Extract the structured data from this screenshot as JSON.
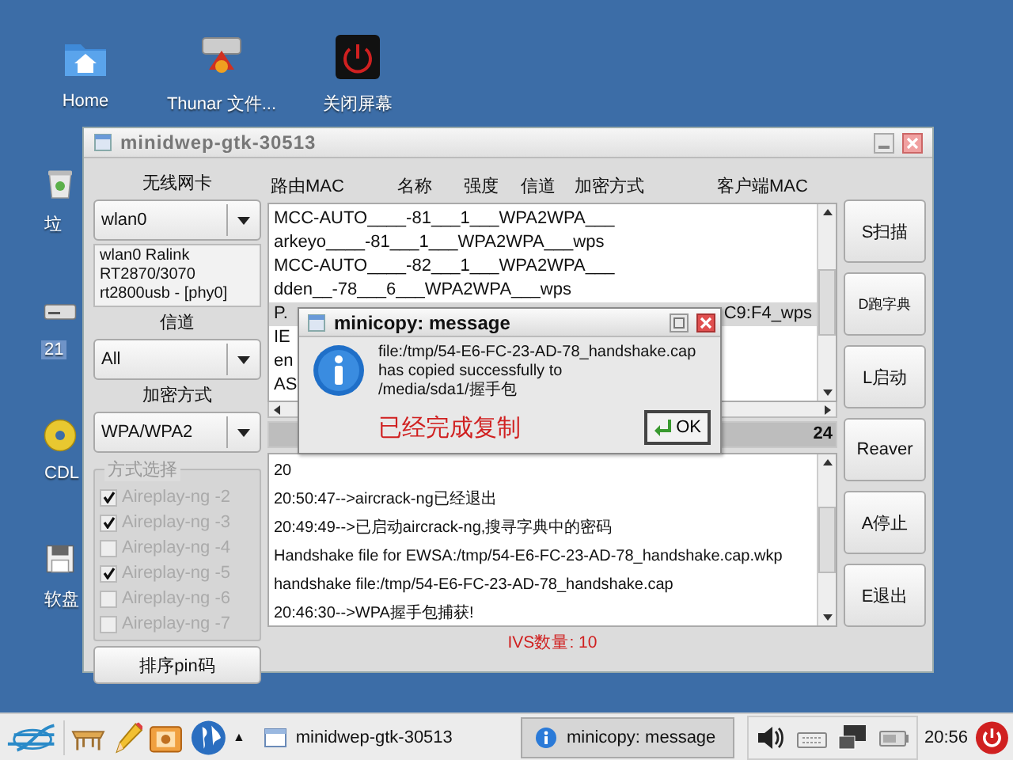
{
  "desktop": {
    "top_icons": [
      {
        "kind": "home",
        "label": "Home",
        "selected": false
      },
      {
        "kind": "cabinet",
        "label": "Thunar 文件...",
        "selected": false
      },
      {
        "kind": "power",
        "label": "关闭屏幕",
        "selected": false
      }
    ],
    "left_icons": [
      {
        "kind": "trash",
        "label": "垃",
        "selected": false
      },
      {
        "kind": "drive",
        "label": "21",
        "selected": true
      },
      {
        "kind": "disc",
        "label": "CDL",
        "selected": false
      },
      {
        "kind": "floppy",
        "label": "软盘",
        "selected": false
      }
    ]
  },
  "main_window": {
    "title": "minidwep-gtk-30513",
    "adapter": {
      "label": "无线网卡",
      "value": "wlan0",
      "info_lines": [
        "wlan0 Ralink",
        "RT2870/3070",
        "rt2800usb - [phy0]"
      ]
    },
    "channel": {
      "label": "信道",
      "value": "All"
    },
    "encryption": {
      "label": "加密方式",
      "value": "WPA/WPA2"
    },
    "methods": {
      "legend": "方式选择",
      "items": [
        {
          "label": "Aireplay-ng -2",
          "checked": true,
          "disabled": true
        },
        {
          "label": "Aireplay-ng -3",
          "checked": true,
          "disabled": true
        },
        {
          "label": "Aireplay-ng -4",
          "checked": false,
          "disabled": true
        },
        {
          "label": "Aireplay-ng -5",
          "checked": true,
          "disabled": true
        },
        {
          "label": "Aireplay-ng -6",
          "checked": false,
          "disabled": true
        },
        {
          "label": "Aireplay-ng -7",
          "checked": false,
          "disabled": true
        }
      ]
    },
    "pin_button": "排序pin码",
    "columns": [
      "路由MAC",
      "名称",
      "强度",
      "信道",
      "加密方式",
      "客户端MAC"
    ],
    "rows": [
      {
        "text": "MCC-AUTO____-81___1___WPA2WPA___",
        "selected": false
      },
      {
        "text": "arkeyo____-81___1___WPA2WPA___wps",
        "selected": false
      },
      {
        "text": "MCC-AUTO____-82___1___WPA2WPA___",
        "selected": false
      },
      {
        "text": "dden__-78___6___WPA2WPA___wps",
        "selected": false
      },
      {
        "text": "P.",
        "tail": "C9:F4_wps",
        "selected": true
      },
      {
        "text": "IE",
        "selected": false
      },
      {
        "text": "en",
        "selected": false
      },
      {
        "text": "AS",
        "selected": false
      }
    ],
    "progress": {
      "text": "24",
      "level": 1
    },
    "log": [
      "20",
      "20:50:47-->aircrack-ng已经退出",
      "20:49:49-->已启动aircrack-ng,搜寻字典中的密码",
      "Handshake file for EWSA:/tmp/54-E6-FC-23-AD-78_handshake.cap.wkp",
      "handshake file:/tmp/54-E6-FC-23-AD-78_handshake.cap",
      "20:46:30-->WPA握手包捕获!"
    ],
    "ivs": "IVS数量: 10",
    "buttons": [
      "S扫描",
      "D跑字典",
      "L启动",
      "Reaver",
      "A停止",
      "E退出"
    ]
  },
  "dialog": {
    "title": "minicopy: message",
    "message_lines": [
      "file:/tmp/54-E6-FC-23-AD-78_handshake.cap",
      "has copied successfully to",
      "/media/sda1/握手包"
    ],
    "status": "已经完成复制",
    "ok": "OK"
  },
  "taskbar": {
    "menu_arrow": "▲",
    "tasks": [
      {
        "kind": "window",
        "label": "minidwep-gtk-30513",
        "selected": false
      },
      {
        "kind": "info",
        "label": "minicopy: message",
        "selected": true
      }
    ],
    "clock": "20:56"
  }
}
